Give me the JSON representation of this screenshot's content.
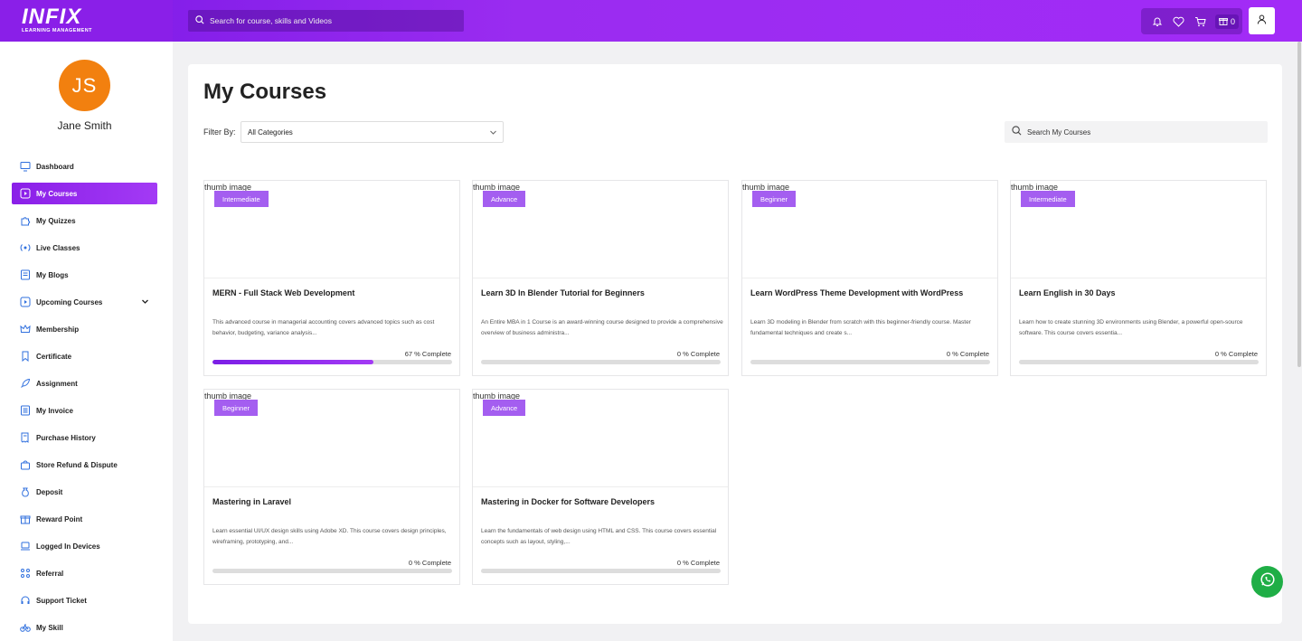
{
  "header": {
    "logo_text": "INFIX",
    "logo_sub": "LEARNING MANAGEMENT",
    "search_placeholder": "Search for course, skills and Videos",
    "cart_count": "0",
    "icons": [
      "bell-icon",
      "heart-icon",
      "cart-icon",
      "gift-icon",
      "user-icon"
    ]
  },
  "user": {
    "initials": "JS",
    "name": "Jane Smith",
    "avatar_color": "#f2800f"
  },
  "sidebar": {
    "items": [
      {
        "label": "Dashboard",
        "icon": "monitor-icon"
      },
      {
        "label": "My Courses",
        "icon": "play-square-icon",
        "active": true
      },
      {
        "label": "My Quizzes",
        "icon": "puzzle-icon"
      },
      {
        "label": "Live Classes",
        "icon": "broadcast-icon"
      },
      {
        "label": "My Blogs",
        "icon": "blog-icon"
      },
      {
        "label": "Upcoming Courses",
        "icon": "play-square-icon",
        "expandable": true
      },
      {
        "label": "Membership",
        "icon": "crown-icon"
      },
      {
        "label": "Certificate",
        "icon": "bookmark-icon"
      },
      {
        "label": "Assignment",
        "icon": "rocket-icon"
      },
      {
        "label": "My Invoice",
        "icon": "list-icon"
      },
      {
        "label": "Purchase History",
        "icon": "receipt-icon"
      },
      {
        "label": "Store Refund & Dispute",
        "icon": "bag-icon"
      },
      {
        "label": "Deposit",
        "icon": "money-bag-icon"
      },
      {
        "label": "Reward Point",
        "icon": "gift-icon"
      },
      {
        "label": "Logged In Devices",
        "icon": "laptop-icon"
      },
      {
        "label": "Referral",
        "icon": "network-icon"
      },
      {
        "label": "Support Ticket",
        "icon": "headset-icon"
      },
      {
        "label": "My Skill",
        "icon": "bike-icon"
      }
    ]
  },
  "main": {
    "title": "My Courses",
    "filter_label": "Filter By:",
    "filter_value": "All Categories",
    "search_placeholder": "Search My Courses",
    "thumb_alt": "thumb image",
    "courses": [
      {
        "level": "Intermediate",
        "title": "MERN - Full Stack Web Development",
        "desc": "This advanced course in managerial accounting covers advanced topics such as cost behavior, budgeting, variance analysis...",
        "progress_text": "67 % Complete",
        "progress": 0.67
      },
      {
        "level": "Advance",
        "title": "Learn 3D In Blender Tutorial for Beginners",
        "desc": "An Entire MBA in 1 Course is an award-winning course designed to provide a comprehensive overview of business administra...",
        "progress_text": "0 % Complete",
        "progress": 0
      },
      {
        "level": "Beginner",
        "title": "Learn WordPress Theme Development with WordPress",
        "desc": "Learn 3D modeling in Blender from scratch with this beginner-friendly course. Master fundamental techniques and create s...",
        "progress_text": "0 % Complete",
        "progress": 0
      },
      {
        "level": "Intermediate",
        "title": "Learn English in 30 Days",
        "desc": "Learn how to create stunning 3D environments using Blender, a powerful open-source software. This course covers essentia...",
        "progress_text": "0 % Complete",
        "progress": 0
      },
      {
        "level": "Beginner",
        "title": "Mastering in Laravel",
        "desc": "Learn essential UI/UX design skills using Adobe XD. This course covers design principles, wireframing, prototyping, and...",
        "progress_text": "0 % Complete",
        "progress": 0
      },
      {
        "level": "Advance",
        "title": "Mastering in Docker for Software Developers",
        "desc": "Learn the fundamentals of web design using HTML and CSS. This course covers essential concepts such as layout, styling,...",
        "progress_text": "0 % Complete",
        "progress": 0
      }
    ]
  },
  "colors": {
    "accent": "#8a1fe8",
    "badge": "#a45ef0",
    "whatsapp": "#1fae46"
  }
}
